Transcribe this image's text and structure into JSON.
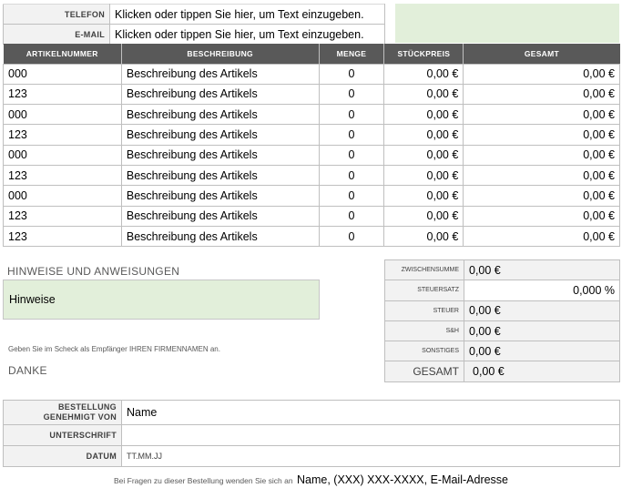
{
  "contact": {
    "phone_label": "TELEFON",
    "phone_value": "Klicken oder tippen Sie hier, um Text einzugeben.",
    "email_label": "E-MAIL",
    "email_value": "Klicken oder tippen Sie hier, um Text einzugeben."
  },
  "items": {
    "headers": [
      "ARTIKELNUMMER",
      "BESCHREIBUNG",
      "MENGE",
      "STÜCKPREIS",
      "GESAMT"
    ],
    "rows": [
      [
        "000",
        "Beschreibung des Artikels",
        "0",
        "0,00 €",
        "0,00 €"
      ],
      [
        "123",
        "Beschreibung des Artikels",
        "0",
        "0,00 €",
        "0,00 €"
      ],
      [
        "000",
        "Beschreibung des Artikels",
        "0",
        "0,00 €",
        "0,00 €"
      ],
      [
        "123",
        "Beschreibung des Artikels",
        "0",
        "0,00 €",
        "0,00 €"
      ],
      [
        "000",
        "Beschreibung des Artikels",
        "0",
        "0,00 €",
        "0,00 €"
      ],
      [
        "123",
        "Beschreibung des Artikels",
        "0",
        "0,00 €",
        "0,00 €"
      ],
      [
        "000",
        "Beschreibung des Artikels",
        "0",
        "0,00 €",
        "0,00 €"
      ],
      [
        "123",
        "Beschreibung des Artikels",
        "0",
        "0,00 €",
        "0,00 €"
      ],
      [
        "123",
        "Beschreibung des Artikels",
        "0",
        "0,00 €",
        "0,00 €"
      ]
    ]
  },
  "notes": {
    "heading": "HINWEISE UND ANWEISUNGEN",
    "box_text": "Hinweise",
    "check_note": "Geben Sie im Scheck als Empfänger IHREN FIRMENNAMEN an.",
    "thanks": "DANKE"
  },
  "totals": {
    "subtotal_label": "ZWISCHENSUMME",
    "subtotal_value": "0,00 €",
    "tax_rate_label": "STEUERSATZ",
    "tax_rate_value": "0,000 %",
    "tax_label": "STEUER",
    "tax_value": "0,00 €",
    "shipping_label": "S&H",
    "shipping_value": "0,00 €",
    "other_label": "SONSTIGES",
    "other_value": "0,00 €",
    "total_label": "GESAMT",
    "total_value": "0,00 €"
  },
  "approval": {
    "approved_label": "BESTELLUNG GENEHMIGT VON",
    "approved_value": "Name",
    "signature_label": "UNTERSCHRIFT",
    "signature_value": "",
    "date_label": "DATUM",
    "date_value": "TT.MM.JJ"
  },
  "footer": {
    "prefix": "Bei Fragen zu dieser Bestellung wenden Sie sich an",
    "contact": "Name, (XXX) XXX-XXXX, E-Mail-Adresse"
  },
  "colors": {
    "header_bg": "#595959",
    "accent_green": "#e2efda",
    "label_bg": "#f2f2f2"
  }
}
